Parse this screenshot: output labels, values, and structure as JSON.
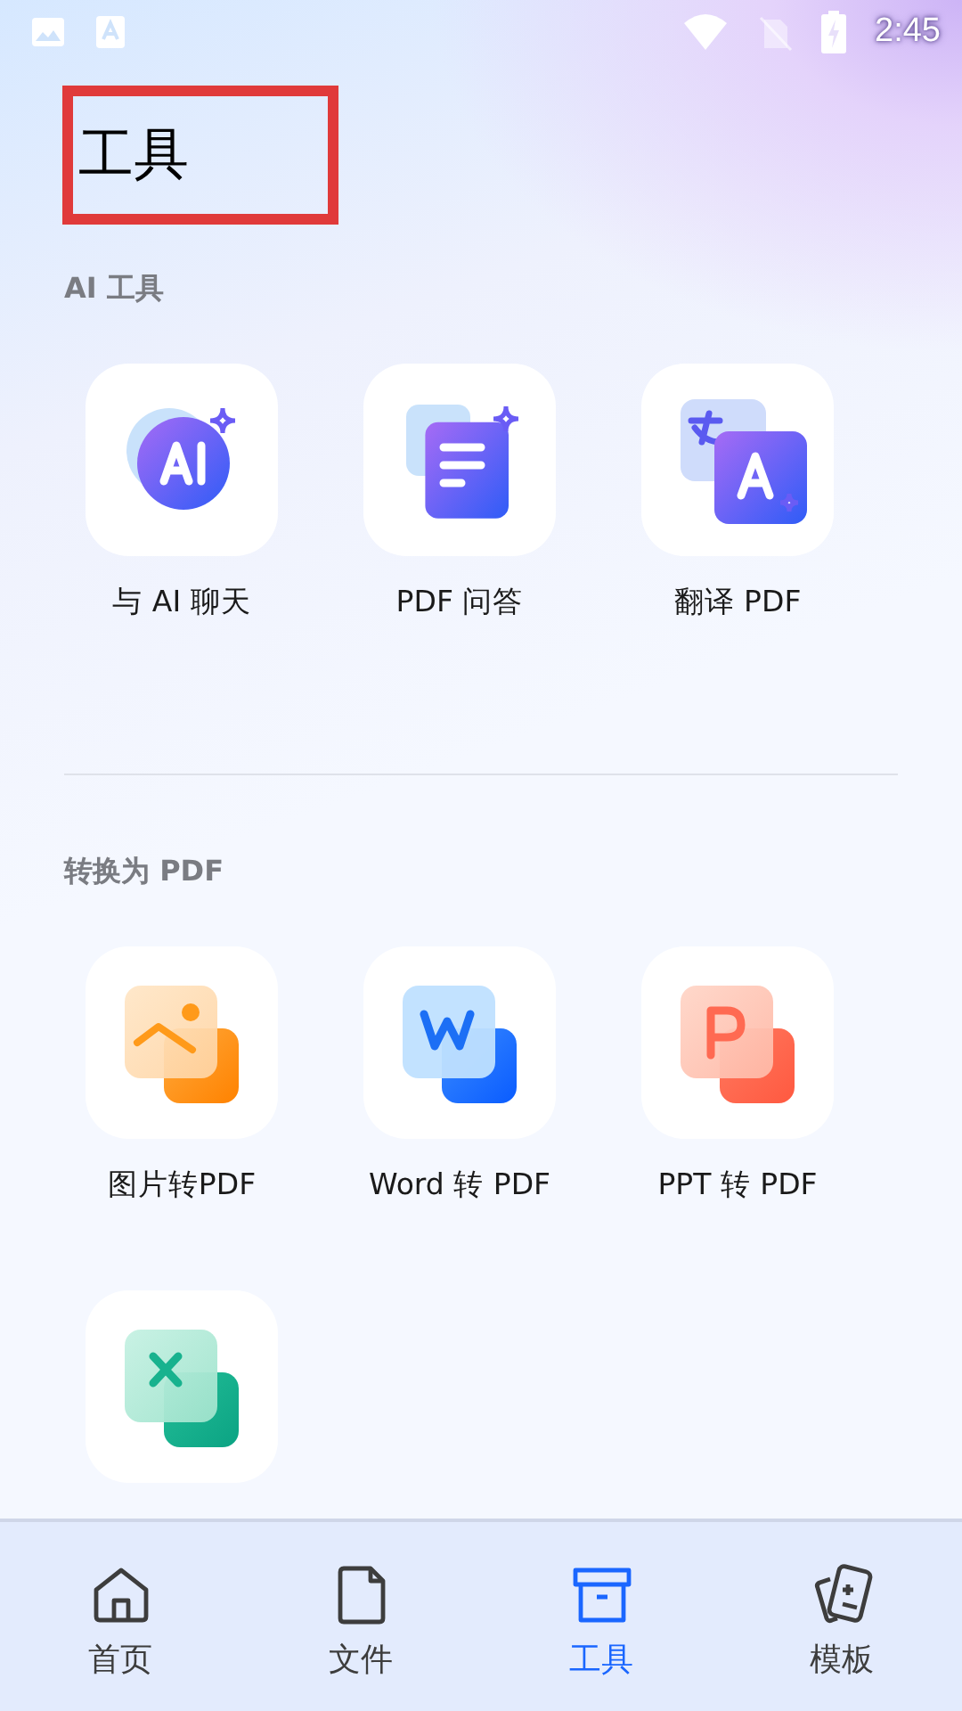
{
  "status_bar": {
    "time": "2:45"
  },
  "header": {
    "title": "工具",
    "highlighted": true
  },
  "sections": [
    {
      "title": "AI 工具",
      "tools": [
        {
          "kind": "ai-chat",
          "label": "与 AI 聊天"
        },
        {
          "kind": "pdf-qa",
          "label": "PDF 问答"
        },
        {
          "kind": "translate",
          "label": "翻译 PDF"
        }
      ]
    },
    {
      "title": "转换为 PDF",
      "tools": [
        {
          "kind": "image",
          "label": "图片转PDF"
        },
        {
          "kind": "word",
          "label": "Word 转 PDF"
        },
        {
          "kind": "ppt",
          "label": "PPT 转 PDF"
        },
        {
          "kind": "excel"
        }
      ]
    }
  ],
  "nav": [
    {
      "kind": "home",
      "label": "首页",
      "selected": false
    },
    {
      "kind": "file",
      "label": "文件",
      "selected": false
    },
    {
      "kind": "toolbox",
      "label": "工具",
      "selected": true
    },
    {
      "kind": "cards",
      "label": "模板",
      "selected": false
    }
  ]
}
